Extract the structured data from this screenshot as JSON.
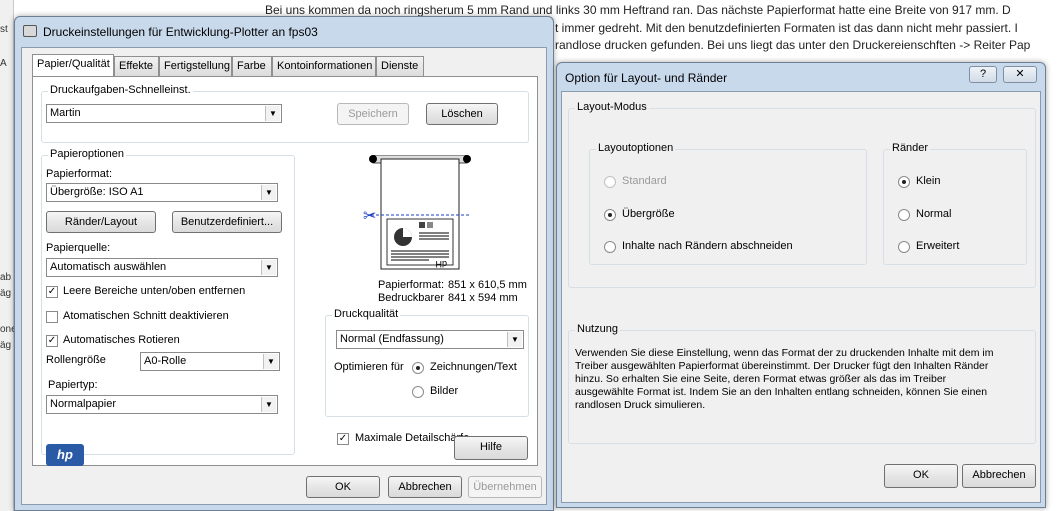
{
  "background": {
    "lines": [
      "Bei uns kommen da noch ringsherum 5 mm Rand und links 30 mm Heftrand ran. Das nächste Papierformat hatte eine Breite von 917 mm. D",
      "t immer gedreht. Mit den benutzdefinierten Formaten ist das dann nicht mehr passiert. I",
      "randlose drucken gefunden. Bei uns liegt das unter den Druckereienschften -> Reiter Pap"
    ],
    "left_fragments": [
      "st",
      "A",
      "ab",
      "äg",
      "one",
      "äg"
    ]
  },
  "main": {
    "title": "Druckeinstellungen für Entwicklung-Plotter an fps03",
    "tabs": [
      "Papier/Qualität",
      "Effekte",
      "Fertigstellung",
      "Farbe",
      "Kontoinformationen",
      "Dienste"
    ],
    "quick": {
      "label": "Druckaufgaben-Schnelleinst.",
      "value": "Martin",
      "save": "Speichern",
      "delete": "Löschen"
    },
    "paper": {
      "group": "Papieroptionen",
      "format_label": "Papierformat:",
      "format_value": "Übergröße: ISO A1",
      "margins_btn": "Ränder/Layout",
      "custom_btn": "Benutzerdefiniert...",
      "source_label": "Papierquelle:",
      "source_value": "Automatisch auswählen",
      "cb1": "Leere Bereiche unten/oben entfernen",
      "cb2": "Atomatischen Schnitt deaktivieren",
      "cb3": "Automatisches Rotieren",
      "roll_label": "Rollengröße",
      "roll_value": "A0-Rolle",
      "type_label": "Papiertyp:",
      "type_value": "Normalpapier"
    },
    "preview": {
      "format_label": "Papierformat:",
      "format_value": "851  x  610,5 mm",
      "printable_label": "Bedruckbarer",
      "printable_value": "841  x  594 mm"
    },
    "quality": {
      "group": "Druckqualität",
      "value": "Normal (Endfassung)",
      "optimize_label": "Optimieren für",
      "opt1": "Zeichnungen/Text",
      "opt2": "Bilder",
      "max_detail": "Maximale Detailschärfe"
    },
    "logo": "hp",
    "help": "Hilfe",
    "ok": "OK",
    "cancel": "Abbrechen",
    "apply": "Übernehmen"
  },
  "dialog": {
    "title": "Option für Layout- und Ränder",
    "help_btn": "?",
    "close_btn": "✕",
    "mode_group": "Layout-Modus",
    "layout_group": "Layoutoptionen",
    "layout_opts": [
      "Standard",
      "Übergröße",
      "Inhalte nach Rändern abschneiden"
    ],
    "margins_group": "Ränder",
    "margin_opts": [
      "Klein",
      "Normal",
      "Erweitert"
    ],
    "usage_group": "Nutzung",
    "usage_text": "Verwenden Sie diese Einstellung, wenn das Format der zu druckenden Inhalte mit dem im Treiber ausgewählten Papierformat übereinstimmt. Der Drucker fügt den Inhalten Ränder hinzu. So erhalten Sie eine Seite, deren Format etwas größer als das im Treiber ausgewählte Format ist. Indem Sie an den Inhalten entlang schneiden, können Sie einen randlosen Druck simulieren.",
    "ok": "OK",
    "cancel": "Abbrechen"
  }
}
